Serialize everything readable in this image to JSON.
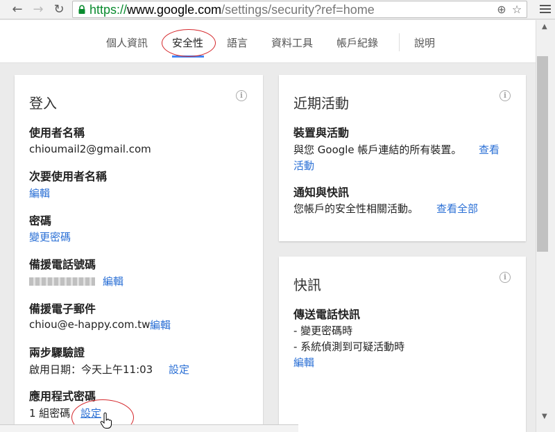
{
  "browser": {
    "url_scheme": "https://",
    "url_host": "www.google.com",
    "url_path": "/settings/security?ref=home",
    "back_icon": "back-arrow-icon",
    "forward_icon": "forward-arrow-icon",
    "reload_icon": "reload-icon"
  },
  "tabs": [
    {
      "label": "個人資訊"
    },
    {
      "label": "安全性"
    },
    {
      "label": "語言"
    },
    {
      "label": "資料工具"
    },
    {
      "label": "帳戶紀錄"
    },
    {
      "label": "說明"
    }
  ],
  "signin": {
    "title": "登入",
    "username_label": "使用者名稱",
    "username_value": "chioumail2@gmail.com",
    "secondary_label": "次要使用者名稱",
    "secondary_edit": "編輯",
    "password_label": "密碼",
    "password_change": "變更密碼",
    "phone_label": "備援電話號碼",
    "phone_edit": "編輯",
    "email_label": "備援電子郵件",
    "email_value": "chiou@e-happy.com.tw",
    "email_edit": "編輯",
    "twostep_label": "兩步驟驗證",
    "twostep_value": "啟用日期：今天上午11:03",
    "twostep_setup": "設定",
    "apppw_label": "應用程式密碼",
    "apppw_value": "1 組密碼",
    "apppw_setup": "設定"
  },
  "recent": {
    "title": "近期活動",
    "devices_label": "裝置與活動",
    "devices_text": "與您 Google 帳戶連結的所有裝置。",
    "devices_link_1": "查看",
    "devices_link_2": "活動",
    "notif_label": "通知與快訊",
    "notif_text": "您帳戶的安全性相關活動。",
    "notif_link": "查看全部"
  },
  "alerts": {
    "title": "快訊",
    "phone_label": "傳送電話快訊",
    "item_1": "- 變更密碼時",
    "item_2": "- 系統偵測到可疑活動時",
    "edit": "編輯"
  },
  "colors": {
    "link": "#2a6fd5",
    "tab_underline": "#4285f4",
    "annotation_red": "#d4262a",
    "secure_green": "#0a8b2f"
  }
}
